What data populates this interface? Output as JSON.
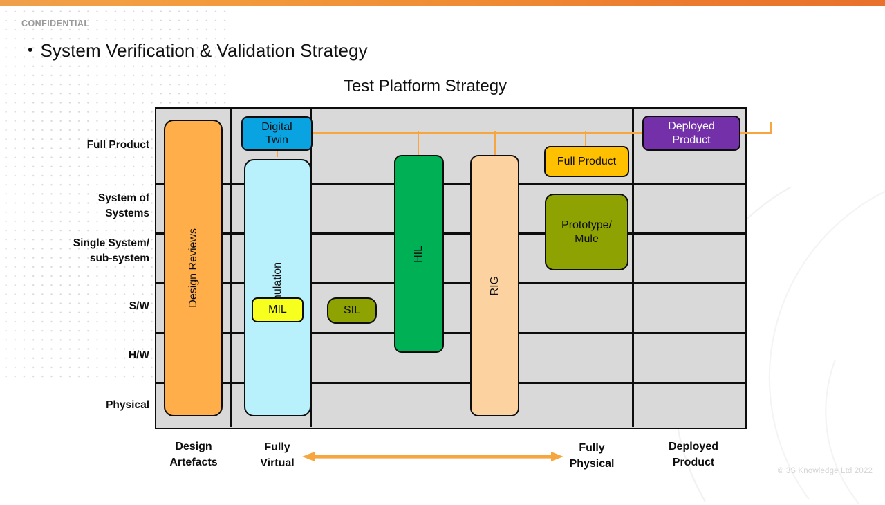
{
  "top_bar": {
    "gradient_from": "#f0a04b",
    "gradient_to": "#e8712b"
  },
  "header": {
    "confidential": "CONFIDENTIAL",
    "bullet_glyph": "•",
    "slide_title": "System Verification & Validation Strategy"
  },
  "chart_title": "Test Platform Strategy",
  "footer": {
    "copyright": "© 3S Knowledge  Ltd 2022"
  },
  "chart_data": {
    "type": "diagram",
    "title": "Test Platform Strategy",
    "ylabel": "",
    "xlabel": "",
    "rows": [
      "Full Product",
      "System of\nSystems",
      "Single System/\nsub-system",
      "S/W",
      "H/W",
      "Physical"
    ],
    "row_labels": {
      "r0": "Full Product",
      "r1_l1": "System of",
      "r1_l2": "Systems",
      "r2_l1": "Single System/",
      "r2_l2": "sub-system",
      "r3": "S/W",
      "r4": "H/W",
      "r5": "Physical"
    },
    "columns": [
      {
        "id": "design",
        "label_l1": "Design",
        "label_l2": "Artefacts"
      },
      {
        "id": "virtual",
        "label_l1": "Fully",
        "label_l2": "Virtual"
      },
      {
        "id": "physical",
        "label_l1": "Fully",
        "label_l2": "Physical"
      },
      {
        "id": "deployed",
        "label_l1": "Deployed",
        "label_l2": "Product"
      }
    ],
    "spectrum_arrow": {
      "from": "Fully Virtual",
      "to": "Fully Physical",
      "color": "#f7a63f",
      "double_headed": true
    },
    "nodes": [
      {
        "id": "design-reviews",
        "label": "Design Reviews",
        "color": "#ffae4a",
        "text_color": "#0d0d0d",
        "orientation": "vertical",
        "column": "design",
        "rows": [
          "Full Product",
          "Physical"
        ]
      },
      {
        "id": "simulation",
        "label": "Simulation",
        "color": "#b8f0fc",
        "text_color": "#0d0d0d",
        "orientation": "vertical",
        "column": "virtual",
        "rows": [
          "Full Product",
          "Physical"
        ]
      },
      {
        "id": "digital-twin",
        "label": "Digital Twin",
        "label_l1": "Digital",
        "label_l2": "Twin",
        "color": "#0aa3e2",
        "text_color": "#0d0d0d",
        "orientation": "horizontal",
        "column": "virtual",
        "rows": [
          "Full Product"
        ]
      },
      {
        "id": "mil",
        "label": "MIL",
        "color": "#f7ff1f",
        "text_color": "#0d0d0d",
        "orientation": "horizontal",
        "column": "virtual",
        "rows": [
          "S/W"
        ]
      },
      {
        "id": "sil",
        "label": "SIL",
        "color": "#8ea302",
        "text_color": "#0d0d0d",
        "orientation": "horizontal",
        "column": "physical",
        "rows": [
          "S/W"
        ]
      },
      {
        "id": "hil",
        "label": "HIL",
        "color": "#00b055",
        "text_color": "#0d0d0d",
        "orientation": "vertical",
        "column": "physical",
        "rows": [
          "Full Product",
          "H/W"
        ]
      },
      {
        "id": "rig",
        "label": "RIG",
        "color": "#fcd2a1",
        "text_color": "#0d0d0d",
        "orientation": "vertical",
        "column": "physical",
        "rows": [
          "Full Product",
          "Physical"
        ]
      },
      {
        "id": "full-product",
        "label": "Full Product",
        "color": "#ffc000",
        "text_color": "#0d0d0d",
        "orientation": "horizontal",
        "column": "physical",
        "rows": [
          "Full Product"
        ]
      },
      {
        "id": "prototype-mule",
        "label": "Prototype/ Mule",
        "label_l1": "Prototype/",
        "label_l2": "Mule",
        "color": "#8ea302",
        "text_color": "#0d0d0d",
        "orientation": "horizontal",
        "column": "physical",
        "rows": [
          "System of Systems",
          "Single System/sub-system"
        ]
      },
      {
        "id": "deployed-product",
        "label": "Deployed Product",
        "label_l1": "Deployed",
        "label_l2": "Product",
        "color": "#7430a8",
        "text_color": "#ffffff",
        "orientation": "horizontal",
        "column": "deployed",
        "rows": [
          "Full Product"
        ]
      }
    ],
    "connectors": [
      {
        "from": "simulation",
        "to": "digital-twin",
        "color": "#f7a63f",
        "arrow": "up"
      },
      {
        "from": "hil",
        "to": "digital-twin",
        "color": "#f7a63f",
        "arrow": "left"
      },
      {
        "from": "rig",
        "to": "digital-twin",
        "color": "#f7a63f",
        "arrow": "left"
      },
      {
        "from": "full-product",
        "to": "digital-twin",
        "color": "#f7a63f",
        "arrow": "left"
      },
      {
        "from": "deployed-product",
        "to": "digital-twin",
        "color": "#f7a63f",
        "arrow": "left"
      }
    ],
    "grid": {
      "rows": 6,
      "columns": 4,
      "cell_fill": "#d9d9d9",
      "border": "#0d0d0d",
      "grid_on": true
    }
  }
}
